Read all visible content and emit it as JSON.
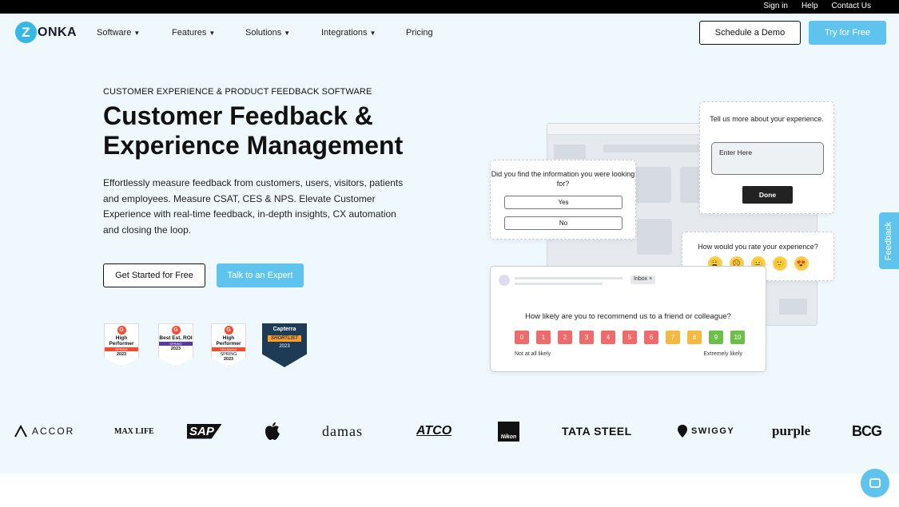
{
  "topbar": {
    "links": [
      "Sign in",
      "Help",
      "Contact Us"
    ]
  },
  "logo": {
    "mark": "Z",
    "text": "ONKA"
  },
  "nav": {
    "items": [
      {
        "label": "Software",
        "caret": true
      },
      {
        "label": "Features",
        "caret": true
      },
      {
        "label": "Solutions",
        "caret": true
      },
      {
        "label": "Integrations",
        "caret": true
      },
      {
        "label": "Pricing",
        "caret": false
      }
    ],
    "demo_label": "Schedule a Demo",
    "try_label": "Try for Free"
  },
  "hero": {
    "eyebrow": "CUSTOMER EXPERIENCE & PRODUCT FEEDBACK SOFTWARE",
    "headline_line1": "Customer Feedback &",
    "headline_line2": "Experience Management",
    "description": "Effortlessly measure feedback from customers, users, visitors, patients and employees. Measure CSAT, CES & NPS. Elevate Customer Experience with real-time feedback, in-depth insights, CX automation and closing the loop.",
    "primary_cta": "Get Started for Free",
    "secondary_cta": "Talk to an Expert"
  },
  "badges": [
    {
      "title": "High Performer",
      "strip": "SPRING",
      "year": "2023",
      "color": "#ff492c"
    },
    {
      "title": "Best Est. ROI",
      "strip": "SPRING",
      "year": "2023",
      "color": "#5a39a2"
    },
    {
      "title": "High Performer",
      "strip": "Mid-Market",
      "sub": "SPRING",
      "year": "2023",
      "color": "#ff492c"
    }
  ],
  "capterra": {
    "name": "Capterra",
    "label": "SHORTLIST",
    "year": "2023"
  },
  "survey_info": {
    "question": "Did you find the information you were looking for?",
    "yes": "Yes",
    "no": "No"
  },
  "survey_text": {
    "question": "Tell us more about your experience.",
    "placeholder": "Enter Here",
    "done": "Done"
  },
  "survey_rating": {
    "question": "How would you rate your experience?",
    "faces": [
      "😩",
      "☹",
      "😐",
      "🙂",
      "😍"
    ]
  },
  "survey_nps": {
    "inbox_tag": "Inbox ×",
    "question": "How likely are you to recommend us to a friend or colleague?",
    "scale": [
      "0",
      "1",
      "2",
      "3",
      "4",
      "5",
      "6",
      "7",
      "8",
      "9",
      "10"
    ],
    "colors": [
      "#ef6b6b",
      "#ef6b6b",
      "#ef6b6b",
      "#ef6b6b",
      "#ef6b6b",
      "#ef6b6b",
      "#ef6b6b",
      "#f5b942",
      "#f5b942",
      "#6cc04a",
      "#6cc04a"
    ],
    "low_label": "Not at all likely",
    "high_label": "Extremely likely"
  },
  "feedback_tab": "Feedback",
  "logos": [
    "ACCOR",
    "MAX LIFE",
    "SAP",
    "",
    "damas",
    "ATCO",
    "Nikon",
    "TATA STEEL",
    "SWIGGY",
    "purple",
    "BCG"
  ]
}
